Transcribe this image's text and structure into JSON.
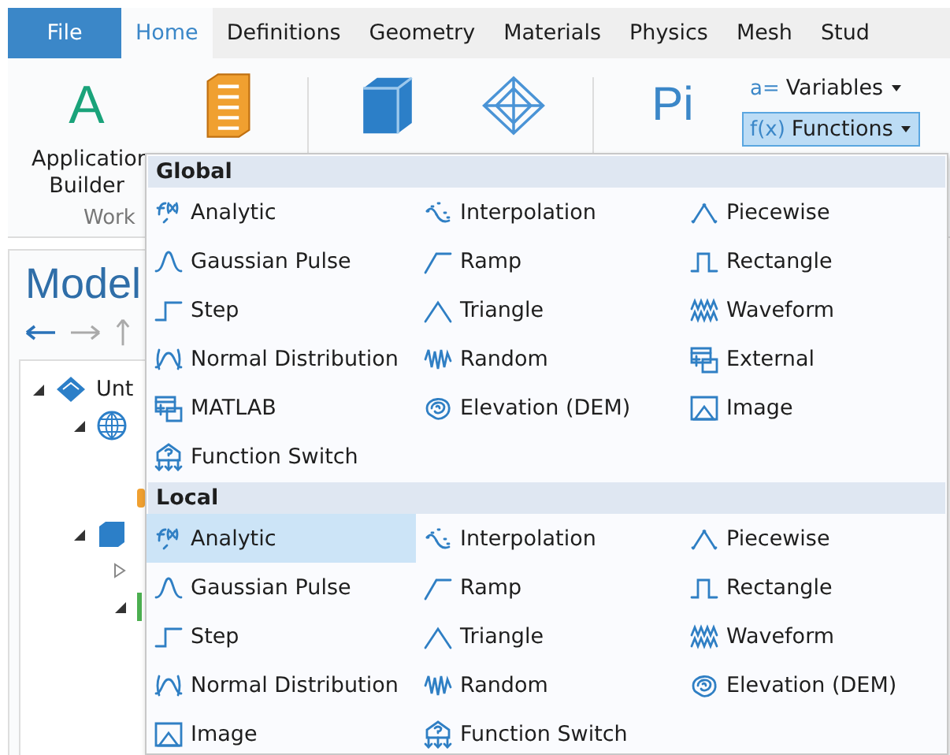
{
  "tabs": [
    {
      "label": "File",
      "kind": "file",
      "selected": false
    },
    {
      "label": "Home",
      "kind": "tab",
      "selected": true
    },
    {
      "label": "Definitions",
      "kind": "tab",
      "selected": false
    },
    {
      "label": "Geometry",
      "kind": "tab",
      "selected": false
    },
    {
      "label": "Materials",
      "kind": "tab",
      "selected": false
    },
    {
      "label": "Physics",
      "kind": "tab",
      "selected": false
    },
    {
      "label": "Mesh",
      "kind": "tab",
      "selected": false
    },
    {
      "label": "Stud",
      "kind": "tab",
      "selected": false
    }
  ],
  "ribbon": {
    "large_buttons": [
      {
        "label": "Application Builder",
        "glyph": "A"
      },
      {
        "kind": "cabinet"
      },
      {
        "kind": "cube"
      },
      {
        "kind": "wireframe"
      },
      {
        "glyph": "Pi"
      }
    ],
    "group_label": "Work",
    "small_buttons": [
      {
        "label": "Variables",
        "glyph": "a=",
        "selected": false
      },
      {
        "label": "Functions",
        "glyph": "f(x)",
        "selected": true
      }
    ]
  },
  "model_panel": {
    "title": "Model",
    "tree": [
      {
        "label": "Unt",
        "kind": "component",
        "expanded": true,
        "children": [
          {
            "kind": "globe",
            "expanded": true,
            "children": [
              {
                "kind": "empty"
              },
              {
                "kind": "marker"
              }
            ]
          },
          {
            "kind": "cube",
            "expanded": true,
            "children": [
              {
                "kind": "empty",
                "expanded": false
              },
              {
                "kind": "bar",
                "expanded": true
              }
            ]
          }
        ]
      }
    ]
  },
  "functions_menu": {
    "sections": [
      {
        "title": "Global",
        "items": [
          {
            "label": "Analytic",
            "kind": "analytic",
            "selected": false
          },
          {
            "label": "Interpolation",
            "kind": "interpolation",
            "selected": false
          },
          {
            "label": "Piecewise",
            "kind": "piecewise",
            "selected": false
          },
          {
            "label": "Gaussian Pulse",
            "kind": "gaussian",
            "selected": false
          },
          {
            "label": "Ramp",
            "kind": "ramp",
            "selected": false
          },
          {
            "label": "Rectangle",
            "kind": "rectangle",
            "selected": false
          },
          {
            "label": "Step",
            "kind": "step",
            "selected": false
          },
          {
            "label": "Triangle",
            "kind": "triangle",
            "selected": false
          },
          {
            "label": "Waveform",
            "kind": "waveform",
            "selected": false
          },
          {
            "label": "Normal Distribution",
            "kind": "normal",
            "selected": false
          },
          {
            "label": "Random",
            "kind": "random",
            "selected": false
          },
          {
            "label": "External",
            "kind": "external",
            "selected": false
          },
          {
            "label": "MATLAB",
            "kind": "matlab",
            "selected": false
          },
          {
            "label": "Elevation (DEM)",
            "kind": "elevation",
            "selected": false
          },
          {
            "label": "Image",
            "kind": "image",
            "selected": false
          },
          {
            "label": "Function Switch",
            "kind": "switch",
            "selected": false
          }
        ]
      },
      {
        "title": "Local",
        "items": [
          {
            "label": "Analytic",
            "kind": "analytic",
            "selected": true
          },
          {
            "label": "Interpolation",
            "kind": "interpolation",
            "selected": false
          },
          {
            "label": "Piecewise",
            "kind": "piecewise",
            "selected": false
          },
          {
            "label": "Gaussian Pulse",
            "kind": "gaussian",
            "selected": false
          },
          {
            "label": "Ramp",
            "kind": "ramp",
            "selected": false
          },
          {
            "label": "Rectangle",
            "kind": "rectangle",
            "selected": false
          },
          {
            "label": "Step",
            "kind": "step",
            "selected": false
          },
          {
            "label": "Triangle",
            "kind": "triangle",
            "selected": false
          },
          {
            "label": "Waveform",
            "kind": "waveform",
            "selected": false
          },
          {
            "label": "Normal Distribution",
            "kind": "normal",
            "selected": false
          },
          {
            "label": "Random",
            "kind": "random",
            "selected": false
          },
          {
            "label": "Elevation (DEM)",
            "kind": "elevation",
            "selected": false
          },
          {
            "label": "Image",
            "kind": "image",
            "selected": false
          },
          {
            "label": "Function Switch",
            "kind": "switch",
            "selected": false
          }
        ]
      }
    ]
  }
}
